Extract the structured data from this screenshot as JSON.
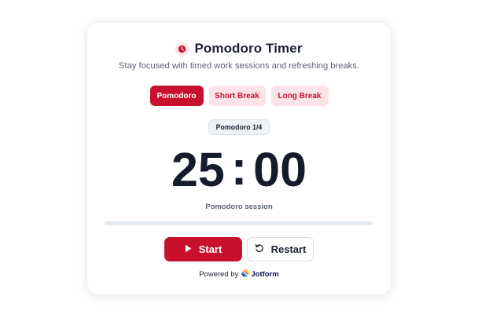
{
  "header": {
    "icon": "clock-icon",
    "title": "Pomodoro Timer",
    "subtitle": "Stay focused with timed work sessions and refreshing breaks."
  },
  "tabs": [
    {
      "label": "Pomodoro",
      "active": true
    },
    {
      "label": "Short Break",
      "active": false
    },
    {
      "label": "Long Break",
      "active": false
    }
  ],
  "session_badge": "Pomodoro 1/4",
  "timer": {
    "minutes": "25",
    "separator": ":",
    "seconds": "00"
  },
  "session_label": "Pomodoro session",
  "progress": {
    "fraction": 0
  },
  "actions": {
    "start": {
      "label": "Start",
      "icon": "play-icon"
    },
    "restart": {
      "label": "Restart",
      "icon": "restart-icon"
    }
  },
  "footer": {
    "powered_by": "Powered by",
    "brand": "Jotform",
    "brand_icon": "jotform-logo-icon"
  },
  "colors": {
    "accent": "#c8102e",
    "accent_soft": "#fbe3e8",
    "text_dark": "#141b2b",
    "text_muted": "#5d6475",
    "track": "#e3e7ee"
  }
}
